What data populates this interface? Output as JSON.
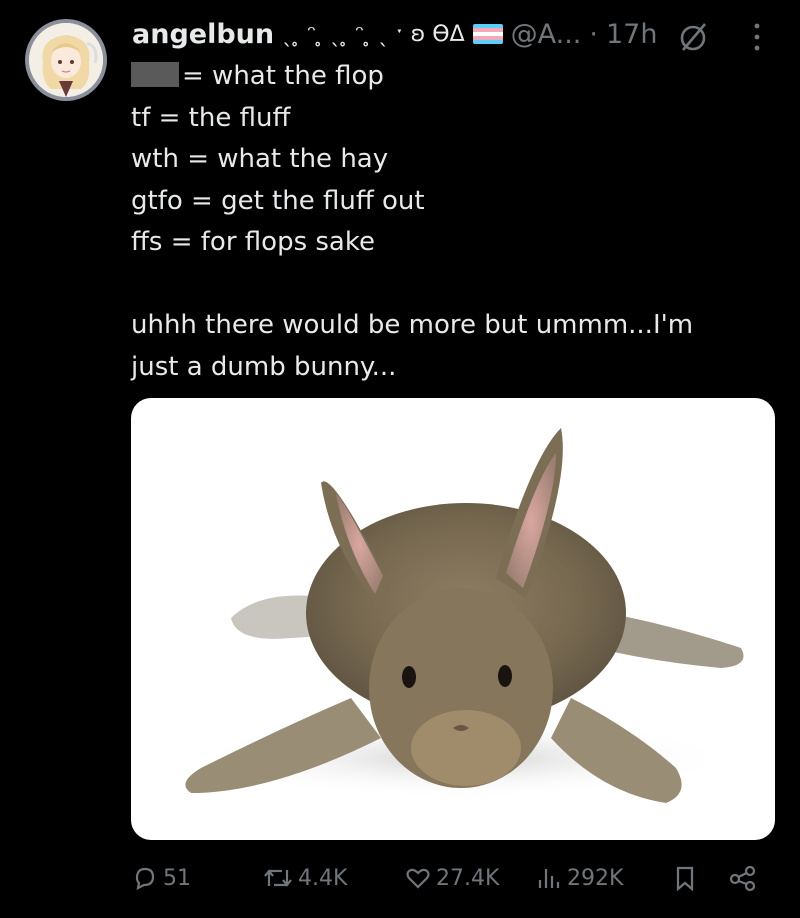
{
  "author": {
    "display_name": "angelbun",
    "name_decoration": "ˎ ̥ ᵔ ̥ ˎ ̥ ᵔ ̥ ˎ ˑ ʚ ϴΔ",
    "handle": "@A...",
    "separator": "·",
    "time": "17h"
  },
  "tweet": {
    "lines": [
      "= what the flop",
      "tf = the fluff",
      "wth = what the hay",
      "gtfo = get the fluff out",
      "ffs = for flops sake"
    ],
    "paragraph2": [
      "uhhh there would be more but ummm...I'm",
      "just a dumb bunny..."
    ]
  },
  "media": {
    "alt": "gray-brown rabbit lying flat with legs spread out"
  },
  "actions": {
    "replies": "51",
    "reposts": "4.4K",
    "likes": "27.4K",
    "views": "292K"
  },
  "colors": {
    "background": "#000000",
    "text": "#e7e9ea",
    "muted": "#71767b"
  }
}
